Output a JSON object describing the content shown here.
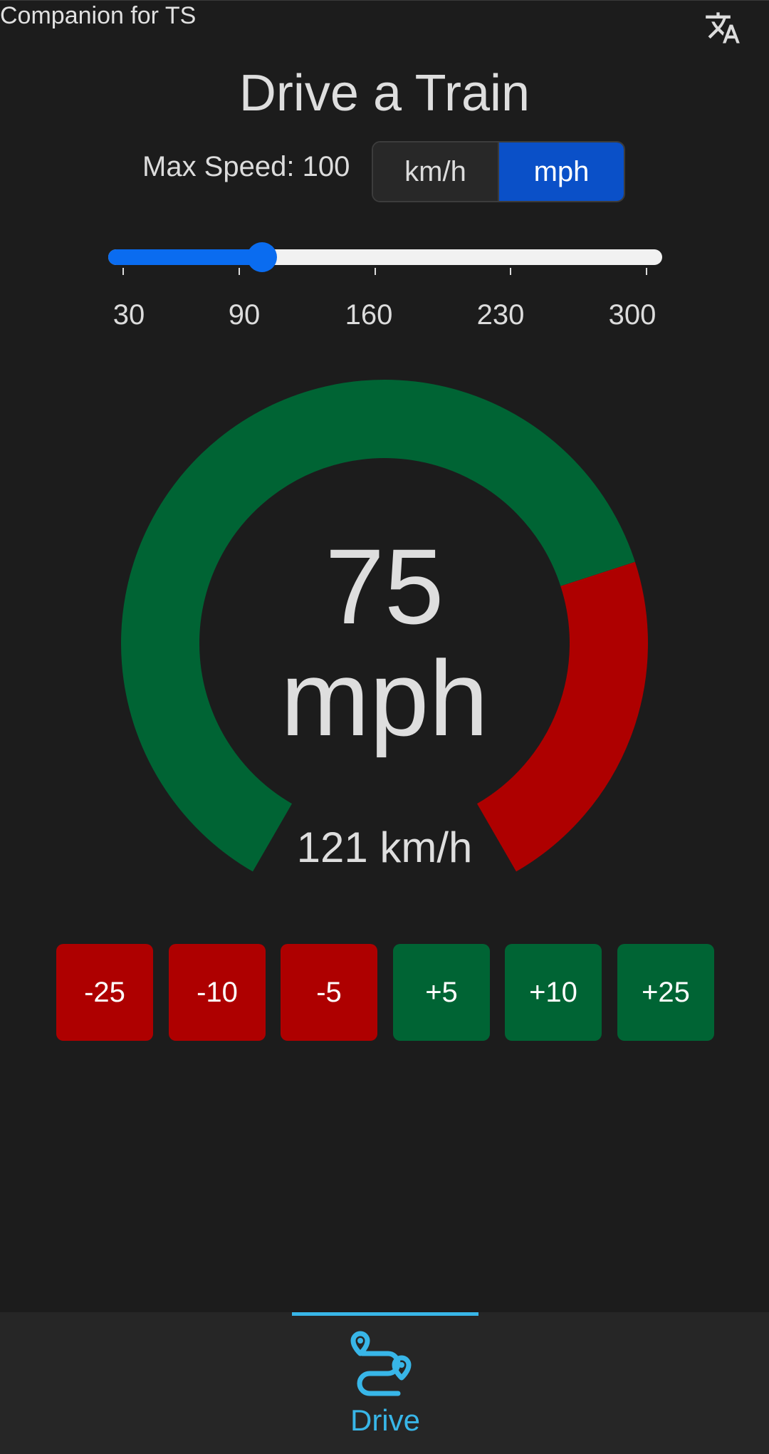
{
  "app": {
    "title": "Companion for TS"
  },
  "page": {
    "title": "Drive a Train"
  },
  "max_speed": {
    "label": "Max Speed: 100",
    "value": 100,
    "slider_min": 30,
    "slider_max": 300,
    "tick_labels": [
      "30",
      "90",
      "160",
      "230",
      "300"
    ]
  },
  "units": {
    "options": [
      "km/h",
      "mph"
    ],
    "selected": "mph"
  },
  "gauge": {
    "speed": "75",
    "unit": "mph",
    "alt_speed": "121 km/h",
    "colors": {
      "safe": "#006434",
      "over": "#ae0000"
    }
  },
  "buttons": [
    "-25",
    "-10",
    "-5",
    "+5",
    "+10",
    "+25"
  ],
  "nav": {
    "items": [
      {
        "label": "Drive",
        "icon": "route-icon",
        "active": true
      }
    ]
  },
  "colors": {
    "accent": "#0a6cf0",
    "nav_accent": "#38b6e8",
    "background": "#1c1c1c"
  }
}
